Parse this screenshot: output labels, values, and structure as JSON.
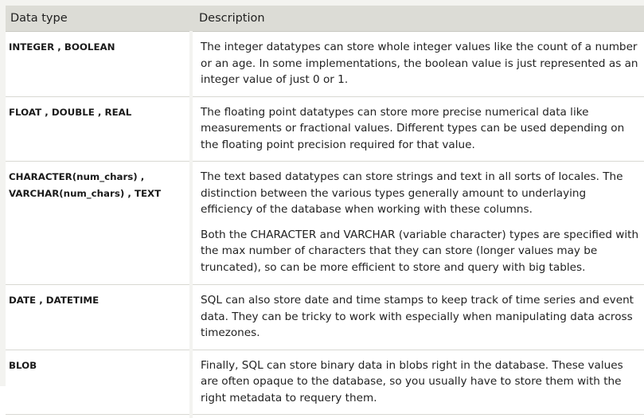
{
  "header": {
    "col_type": "Data type",
    "col_description": "Description"
  },
  "rows": [
    {
      "type": "INTEGER ,  BOOLEAN",
      "description": [
        "The integer datatypes can store whole integer values like the count of a number or an age. In some implementations, the boolean value is just represented as an integer value of just 0 or 1."
      ]
    },
    {
      "type": "FLOAT ,  DOUBLE ,  REAL",
      "description": [
        "The floating point datatypes can store more precise numerical data like measurements or fractional values. Different types can be used depending on the floating point precision required for that value."
      ]
    },
    {
      "type_line1": "CHARACTER(num_chars) ,",
      "type_line2": "VARCHAR(num_chars) ,  TEXT",
      "description": [
        "The text based datatypes can store strings and text in all sorts of locales. The distinction between the various types generally amount to underlaying efficiency of the database when working with these columns.",
        "Both the CHARACTER and VARCHAR (variable character) types are specified with the max number of characters that they can store (longer values may be truncated), so can be more efficient to store and query with big tables."
      ]
    },
    {
      "type": "DATE ,  DATETIME",
      "description": [
        "SQL can also store date and time stamps to keep track of time series and event data. They can be tricky to work with especially when manipulating data across timezones."
      ]
    },
    {
      "type": "BLOB",
      "description": [
        "Finally, SQL can store binary data in blobs right in the database. These values are often opaque to the database, so you usually have to store them with the right metadata to requery them."
      ]
    }
  ]
}
